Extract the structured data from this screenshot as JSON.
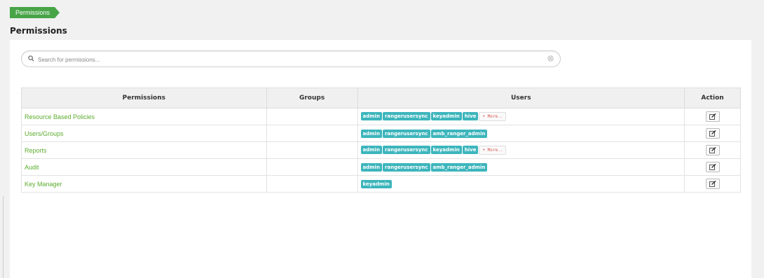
{
  "breadcrumb": {
    "label": "Permissions"
  },
  "page": {
    "title": "Permissions"
  },
  "search": {
    "placeholder": "Search for permissions..."
  },
  "table": {
    "headers": {
      "permissions": "Permissions",
      "groups": "Groups",
      "users": "Users",
      "action": "Action"
    },
    "more_label": "+ More..",
    "rows": [
      {
        "permission": "Resource Based Policies",
        "groups": "",
        "users": [
          "admin",
          "rangerusersync",
          "keyadmin",
          "hive"
        ],
        "more": true
      },
      {
        "permission": "Users/Groups",
        "groups": "",
        "users": [
          "admin",
          "rangerusersync",
          "amb_ranger_admin"
        ],
        "more": false
      },
      {
        "permission": "Reports",
        "groups": "",
        "users": [
          "admin",
          "rangerusersync",
          "keyadmin",
          "hive"
        ],
        "more": true
      },
      {
        "permission": "Audit",
        "groups": "",
        "users": [
          "admin",
          "rangerusersync",
          "amb_ranger_admin"
        ],
        "more": false
      },
      {
        "permission": "Key Manager",
        "groups": "",
        "users": [
          "keyadmin"
        ],
        "more": false
      }
    ]
  },
  "colors": {
    "breadcrumb": "#47a447",
    "link": "#5cad2e",
    "user_label": "#3db5bc",
    "more_text": "#d9534f"
  },
  "icons": {
    "search": "search-icon",
    "clear": "clear-icon",
    "edit": "edit-icon"
  }
}
